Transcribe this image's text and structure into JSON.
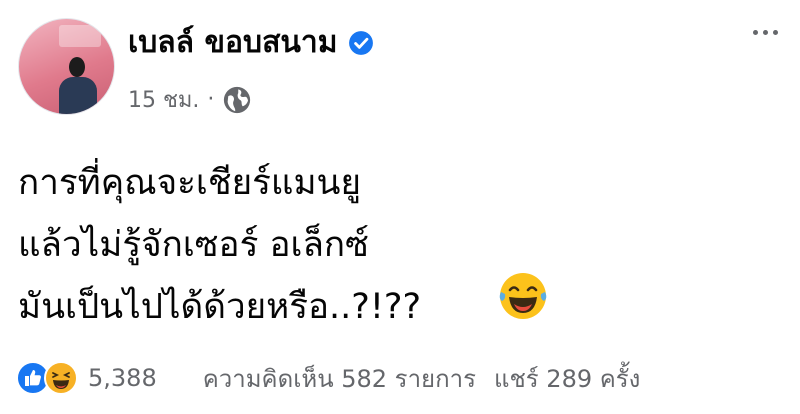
{
  "post": {
    "author": "เบลล์ ขอบสนาม",
    "time": "15 ชม.",
    "separator": "·",
    "privacy_icon": "globe-icon",
    "verified_icon": "verified-badge-icon",
    "text_lines": [
      "การที่คุณจะเชียร์แมนยู",
      "แล้วไม่รู้จักเซอร์ อเล็กซ์",
      "มันเป็นไปได้ด้วยหรือ..?!??"
    ],
    "emoji": "laughing-tears-emoji"
  },
  "footer": {
    "reaction_count": "5,388",
    "comments": "ความคิดเห็น 582 รายการ",
    "shares": "แชร์ 289 ครั้ง"
  },
  "colors": {
    "verified": "#1877f2",
    "meta_text": "#65676b",
    "like": "#1877f2",
    "haha": "#f7b125"
  }
}
